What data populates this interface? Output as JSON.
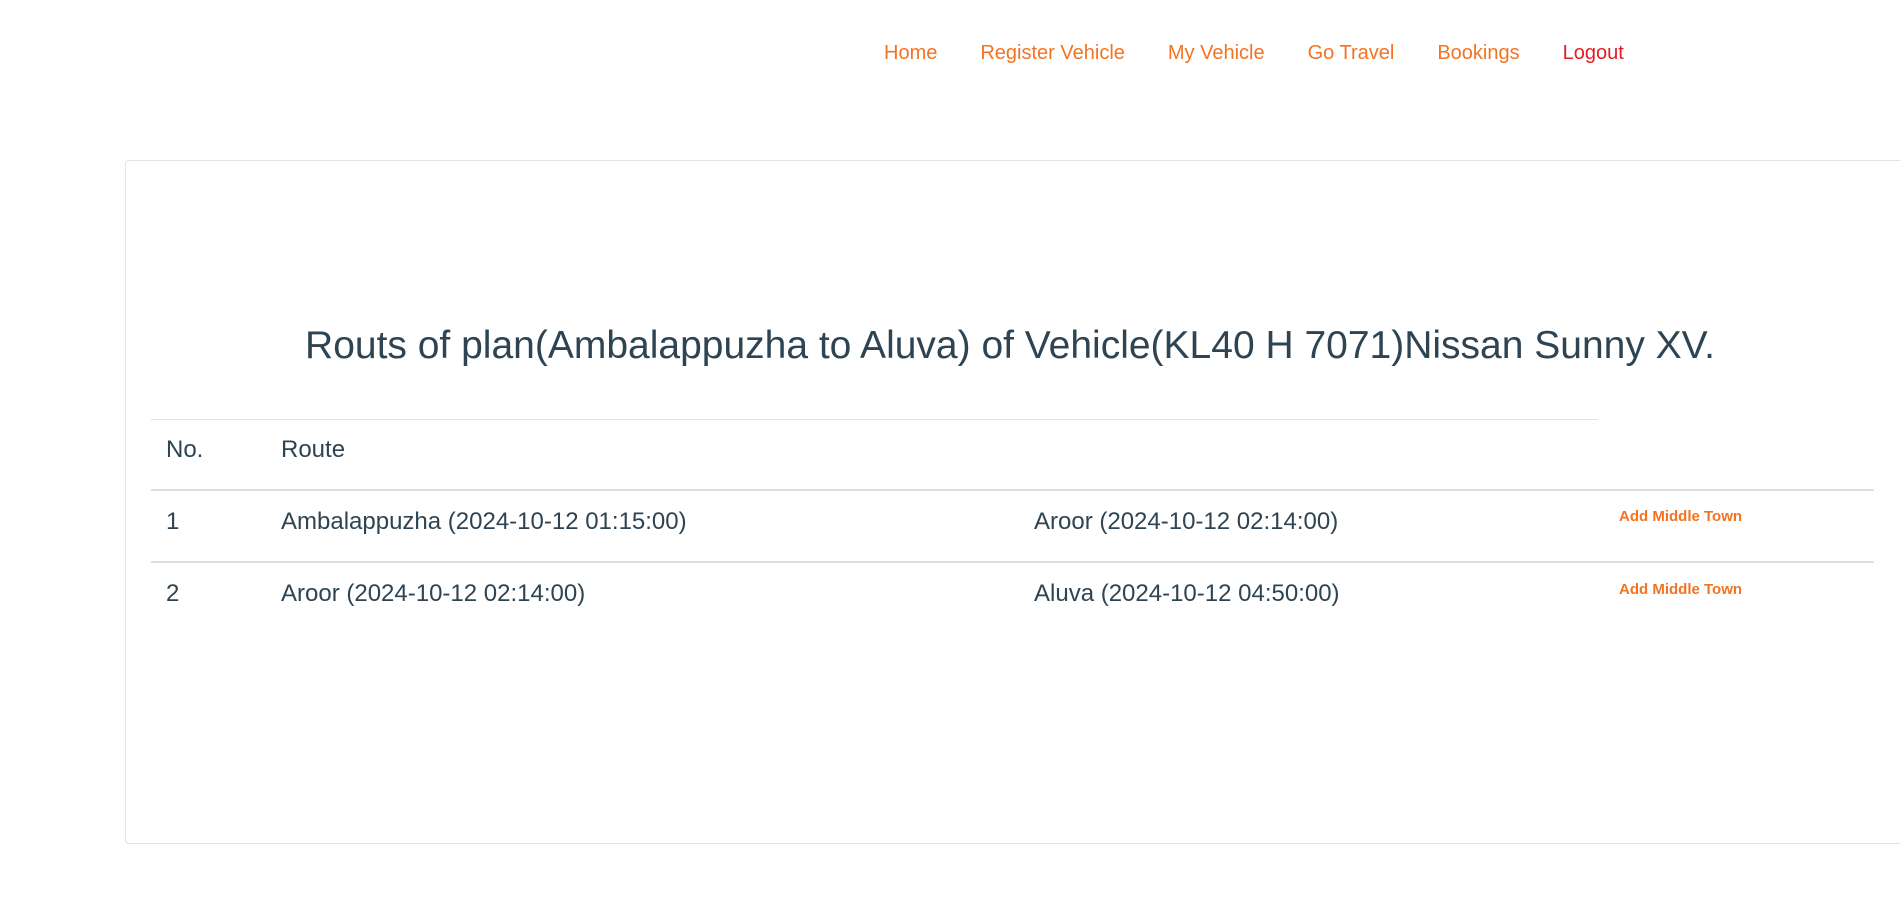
{
  "nav": {
    "items": [
      {
        "label": "Home"
      },
      {
        "label": "Register Vehicle"
      },
      {
        "label": "My Vehicle"
      },
      {
        "label": "Go Travel"
      },
      {
        "label": "Bookings"
      },
      {
        "label": "Logout"
      }
    ]
  },
  "main": {
    "title": "Routs of plan(Ambalappuzha to Aluva) of Vehicle(KL40 H 7071)Nissan Sunny XV.",
    "table": {
      "headers": [
        "No.",
        "Route"
      ],
      "rows": [
        {
          "no": "1",
          "from": "Ambalappuzha (2024-10-12 01:15:00)",
          "to": "Aroor (2024-10-12 02:14:00)",
          "action": "Add Middle Town"
        },
        {
          "no": "2",
          "from": "Aroor (2024-10-12 02:14:00)",
          "to": "Aluva (2024-10-12 04:50:00)",
          "action": "Add Middle Town"
        }
      ]
    }
  },
  "colors": {
    "accent": "#f47321",
    "logout": "#e51c23",
    "text": "#2e4452",
    "border": "#e3e3e3"
  }
}
